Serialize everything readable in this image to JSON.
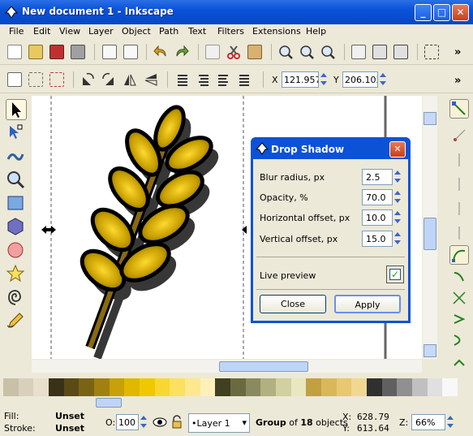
{
  "window": {
    "title": "New document 1 - Inkscape",
    "minimize": "_",
    "maximize": "□",
    "close": "✕"
  },
  "menu": [
    "File",
    "Edit",
    "View",
    "Layer",
    "Object",
    "Path",
    "Text",
    "Filters",
    "Extensions",
    "Help"
  ],
  "toolbar2": {
    "x_label": "X",
    "x_value": "121.957",
    "y_label": "Y",
    "y_value": "206.103",
    "more": "»"
  },
  "toolbar1": {
    "more": "»"
  },
  "dialog": {
    "title": "Drop Shadow",
    "close": "✕",
    "fields": [
      {
        "label": "Blur radius, px",
        "value": "2.5"
      },
      {
        "label": "Opacity, %",
        "value": "70.0"
      },
      {
        "label": "Horizontal offset, px",
        "value": "10.0"
      },
      {
        "label": "Vertical offset, px",
        "value": "15.0"
      }
    ],
    "live_preview": "Live preview",
    "close_button": "Close",
    "apply_button": "Apply"
  },
  "palette": [
    "#c8c0a8",
    "#d8d0bc",
    "#e8e0cc",
    "#3a3216",
    "#5a4a18",
    "#7a6414",
    "#a08010",
    "#c8a008",
    "#e0b800",
    "#f0c800",
    "#f8d830",
    "#fce060",
    "#fde890",
    "#fef0b8",
    "#404020",
    "#6a6a40",
    "#8a8a60",
    "#b0b080",
    "#d0d0a0",
    "#e8e8c0",
    "#c0a040",
    "#d8b858",
    "#e8c870",
    "#f0d890",
    "#303030",
    "#606060",
    "#909090",
    "#c0c0c0",
    "#e0e0e0",
    "#f8f8f8"
  ],
  "status": {
    "fill_label": "Fill:",
    "fill_value": "Unset",
    "stroke_label": "Stroke:",
    "stroke_value": "Unset",
    "opacity_label": "O:",
    "opacity_value": "100",
    "layer": "•Layer 1",
    "message_group": "Group",
    "message_of": " of ",
    "message_count": "18",
    "message_objects": " objects",
    "x_label": "X:",
    "x_value": "628.79",
    "y_label": "Y:",
    "y_value": "613.64",
    "zoom_label": "Z:",
    "zoom_value": "66%"
  },
  "colors": {
    "wheat_fill": "#c8a000",
    "wheat_stroke": "#000000",
    "shadow": "#2a2a2a",
    "stem": "#8a6a10"
  }
}
